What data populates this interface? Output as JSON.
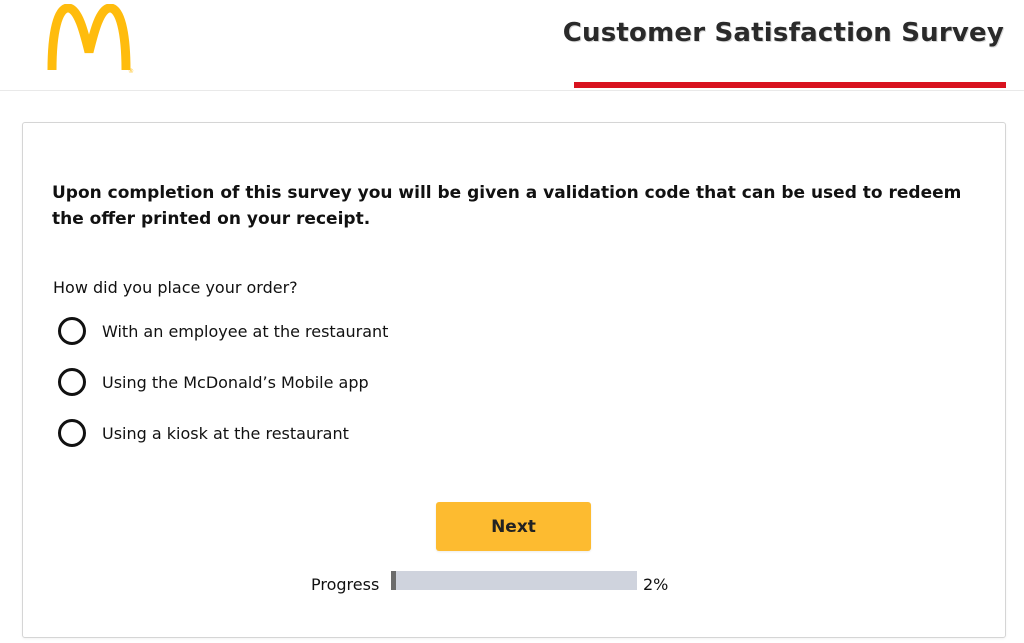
{
  "header": {
    "logo_icon": "mcdonalds-golden-arches-logo",
    "title": "Customer Satisfaction Survey",
    "accent_color": "#d8121f",
    "logo_color": "#ffbc0d"
  },
  "survey": {
    "intro": "Upon completion of this survey you will be given a validation code that can be used to redeem the offer printed on your receipt.",
    "question": "How did you place your order?",
    "options": [
      {
        "label": "With an employee at the restaurant",
        "selected": false
      },
      {
        "label": "Using the McDonald’s Mobile app",
        "selected": false
      },
      {
        "label": "Using a kiosk at the restaurant",
        "selected": false
      }
    ],
    "next_label": "Next",
    "next_color": "#fdbb30"
  },
  "progress": {
    "label": "Progress",
    "value_text": "2%",
    "value": 0.02
  }
}
